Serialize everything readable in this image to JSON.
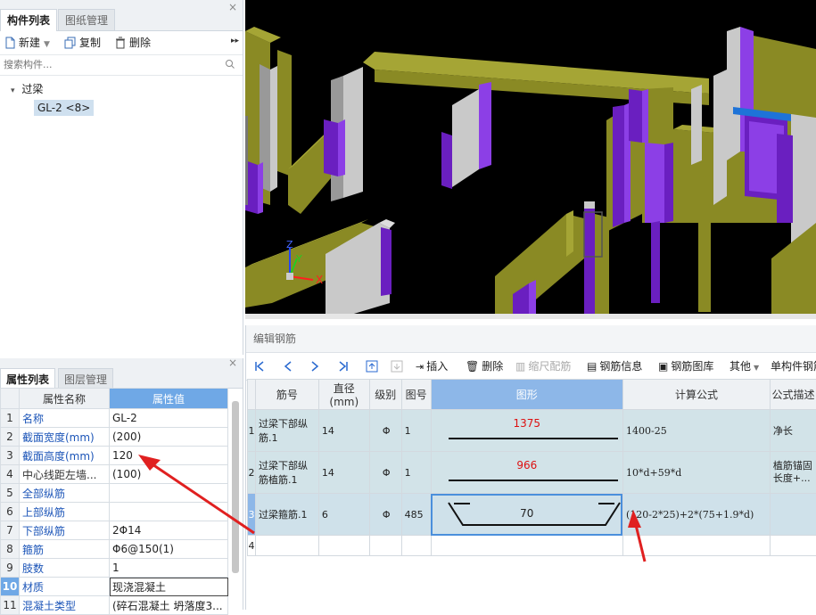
{
  "left_top": {
    "tabs": [
      "构件列表",
      "图纸管理"
    ],
    "close": "×",
    "toolbar": {
      "new": "新建",
      "copy": "复制",
      "delete": "删除"
    },
    "search_placeholder": "搜索构件...",
    "tree": {
      "group": "过梁",
      "item": "GL-2 <8>"
    }
  },
  "left_bottom": {
    "tabs": [
      "属性列表",
      "图层管理"
    ],
    "close": "×",
    "headers": [
      "属性名称",
      "属性值"
    ],
    "rows": [
      {
        "num": "1",
        "name": "名称",
        "value": "GL-2"
      },
      {
        "num": "2",
        "name": "截面宽度(mm)",
        "value": "(200)"
      },
      {
        "num": "3",
        "name": "截面高度(mm)",
        "value": "120"
      },
      {
        "num": "4",
        "name": "中心线距左墙...",
        "value": "(100)"
      },
      {
        "num": "5",
        "name": "全部纵筋",
        "value": ""
      },
      {
        "num": "6",
        "name": "上部纵筋",
        "value": ""
      },
      {
        "num": "7",
        "name": "下部纵筋",
        "value": "2Φ14"
      },
      {
        "num": "8",
        "name": "箍筋",
        "value": "Φ6@150(1)"
      },
      {
        "num": "9",
        "name": "肢数",
        "value": "1"
      },
      {
        "num": "10",
        "name": "材质",
        "value": "现浇混凝土"
      },
      {
        "num": "11",
        "name": "混凝土类型",
        "value": "(碎石混凝土 坍落度3..."
      }
    ]
  },
  "axis": {
    "x": "X",
    "y": "Y",
    "z": "Z"
  },
  "rebar_editor": {
    "title": "编辑钢筋",
    "toolbar": {
      "insert": "插入",
      "delete": "删除",
      "scale": "缩尺配筋",
      "info": "钢筋信息",
      "library": "钢筋图库",
      "other": "其他",
      "single": "单构件钢筋"
    },
    "headers": [
      "筋号",
      "直径(mm)",
      "级别",
      "图号",
      "图形",
      "计算公式",
      "公式描述"
    ],
    "rows": [
      {
        "num": "1",
        "name": "过梁下部纵筋.1",
        "dia": "14",
        "grade": "Φ",
        "fig_no": "1",
        "shape_label": "1375",
        "formula": "1400-25",
        "desc": "净长"
      },
      {
        "num": "2",
        "name": "过梁下部纵筋植筋.1",
        "dia": "14",
        "grade": "Φ",
        "fig_no": "1",
        "shape_label": "966",
        "formula": "10*d+59*d",
        "desc": "植筋锚固长度+..."
      },
      {
        "num": "3",
        "name": "过梁箍筋.1",
        "dia": "6",
        "grade": "Φ",
        "fig_no": "485",
        "shape_label": "70",
        "formula": "(120-2*25)+2*(75+1.9*d)",
        "desc": ""
      },
      {
        "num": "4",
        "name": "",
        "dia": "",
        "grade": "",
        "fig_no": "",
        "shape_label": "",
        "formula": "",
        "desc": ""
      }
    ]
  }
}
